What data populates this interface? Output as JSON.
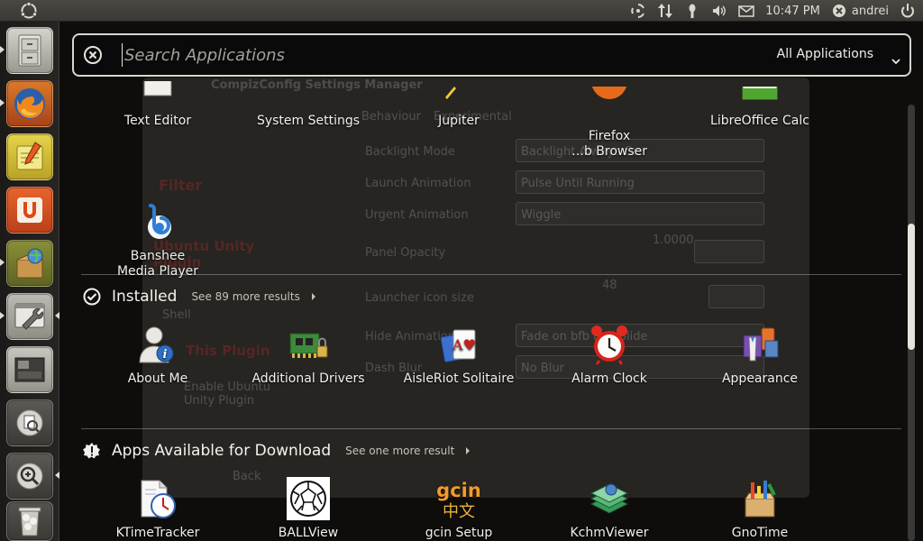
{
  "panel": {
    "clock": "10:47 PM",
    "user": "andrei"
  },
  "launcher": {
    "items": [
      {
        "icon": "file-cabinet-icon"
      },
      {
        "icon": "firefox-icon"
      },
      {
        "icon": "text-editor-icon"
      },
      {
        "icon": "ubuntu-software-center-icon"
      },
      {
        "icon": "package-installer-icon"
      },
      {
        "icon": "system-settings-icon"
      },
      {
        "icon": "workspace-switcher-icon"
      },
      {
        "icon": "dash-apps-icon"
      },
      {
        "icon": "dash-files-icon"
      },
      {
        "icon": "trash-icon"
      }
    ]
  },
  "search": {
    "placeholder": "Search Applications",
    "filter": "All Applications"
  },
  "ghost": {
    "title": "CompizConfig Settings Manager",
    "tab_behaviour": "Behaviour",
    "tab_experimental": "Experimental",
    "rows": [
      {
        "label": "Backlight Mode",
        "value": "Backlight Always On"
      },
      {
        "label": "Launch Animation",
        "value": "Pulse Until Running"
      },
      {
        "label": "Urgent Animation",
        "value": "Wiggle"
      },
      {
        "label": "Panel Opacity",
        "value": "1.0000"
      },
      {
        "label": "Launcher icon size",
        "value": "48"
      },
      {
        "label": "Hide Animation",
        "value": "Fade on bfb and Slide"
      },
      {
        "label": "Dash Blur",
        "value": "No Blur"
      }
    ],
    "left_filter": "Filter",
    "left_plugin": "Ubuntu Unity Plugin",
    "left_this_plugin": "This Plugin",
    "left_enable": "Enable Ubuntu Unity Plugin",
    "left_back": "Back",
    "left_shell": "Shell"
  },
  "top_apps": [
    {
      "name": "Text Editor",
      "icon": "text-editor-icon"
    },
    {
      "name": "System Settings",
      "icon": "system-settings-icon"
    },
    {
      "name": "Jupiter",
      "icon": "jupiter-icon"
    },
    {
      "name": "Firefox\n…b Browser",
      "icon": "firefox-icon"
    },
    {
      "name": "LibreOffice Calc",
      "icon": "libreoffice-calc-icon"
    },
    {
      "name": "Banshee\nMedia Player",
      "icon": "banshee-icon"
    }
  ],
  "installed": {
    "title": "Installed",
    "more": "See 89 more results",
    "apps": [
      {
        "name": "About Me",
        "icon": "about-me-icon"
      },
      {
        "name": "Additional Drivers",
        "icon": "additional-drivers-icon"
      },
      {
        "name": "AisleRiot Solitaire",
        "icon": "solitaire-icon"
      },
      {
        "name": "Alarm Clock",
        "icon": "alarm-clock-icon"
      },
      {
        "name": "Appearance",
        "icon": "appearance-icon"
      }
    ]
  },
  "download": {
    "title": "Apps Available for Download",
    "more": "See one more result",
    "apps": [
      {
        "name": "KTimeTracker",
        "icon": "ktimetracker-icon"
      },
      {
        "name": "BALLView",
        "icon": "ballview-icon"
      },
      {
        "name": "gcin Setup",
        "icon": "gcin-icon",
        "logo_text": "gcin",
        "logo_sub": "中文"
      },
      {
        "name": "KchmViewer",
        "icon": "kchmviewer-icon"
      },
      {
        "name": "GnoTime",
        "icon": "gnotime-icon"
      }
    ]
  }
}
